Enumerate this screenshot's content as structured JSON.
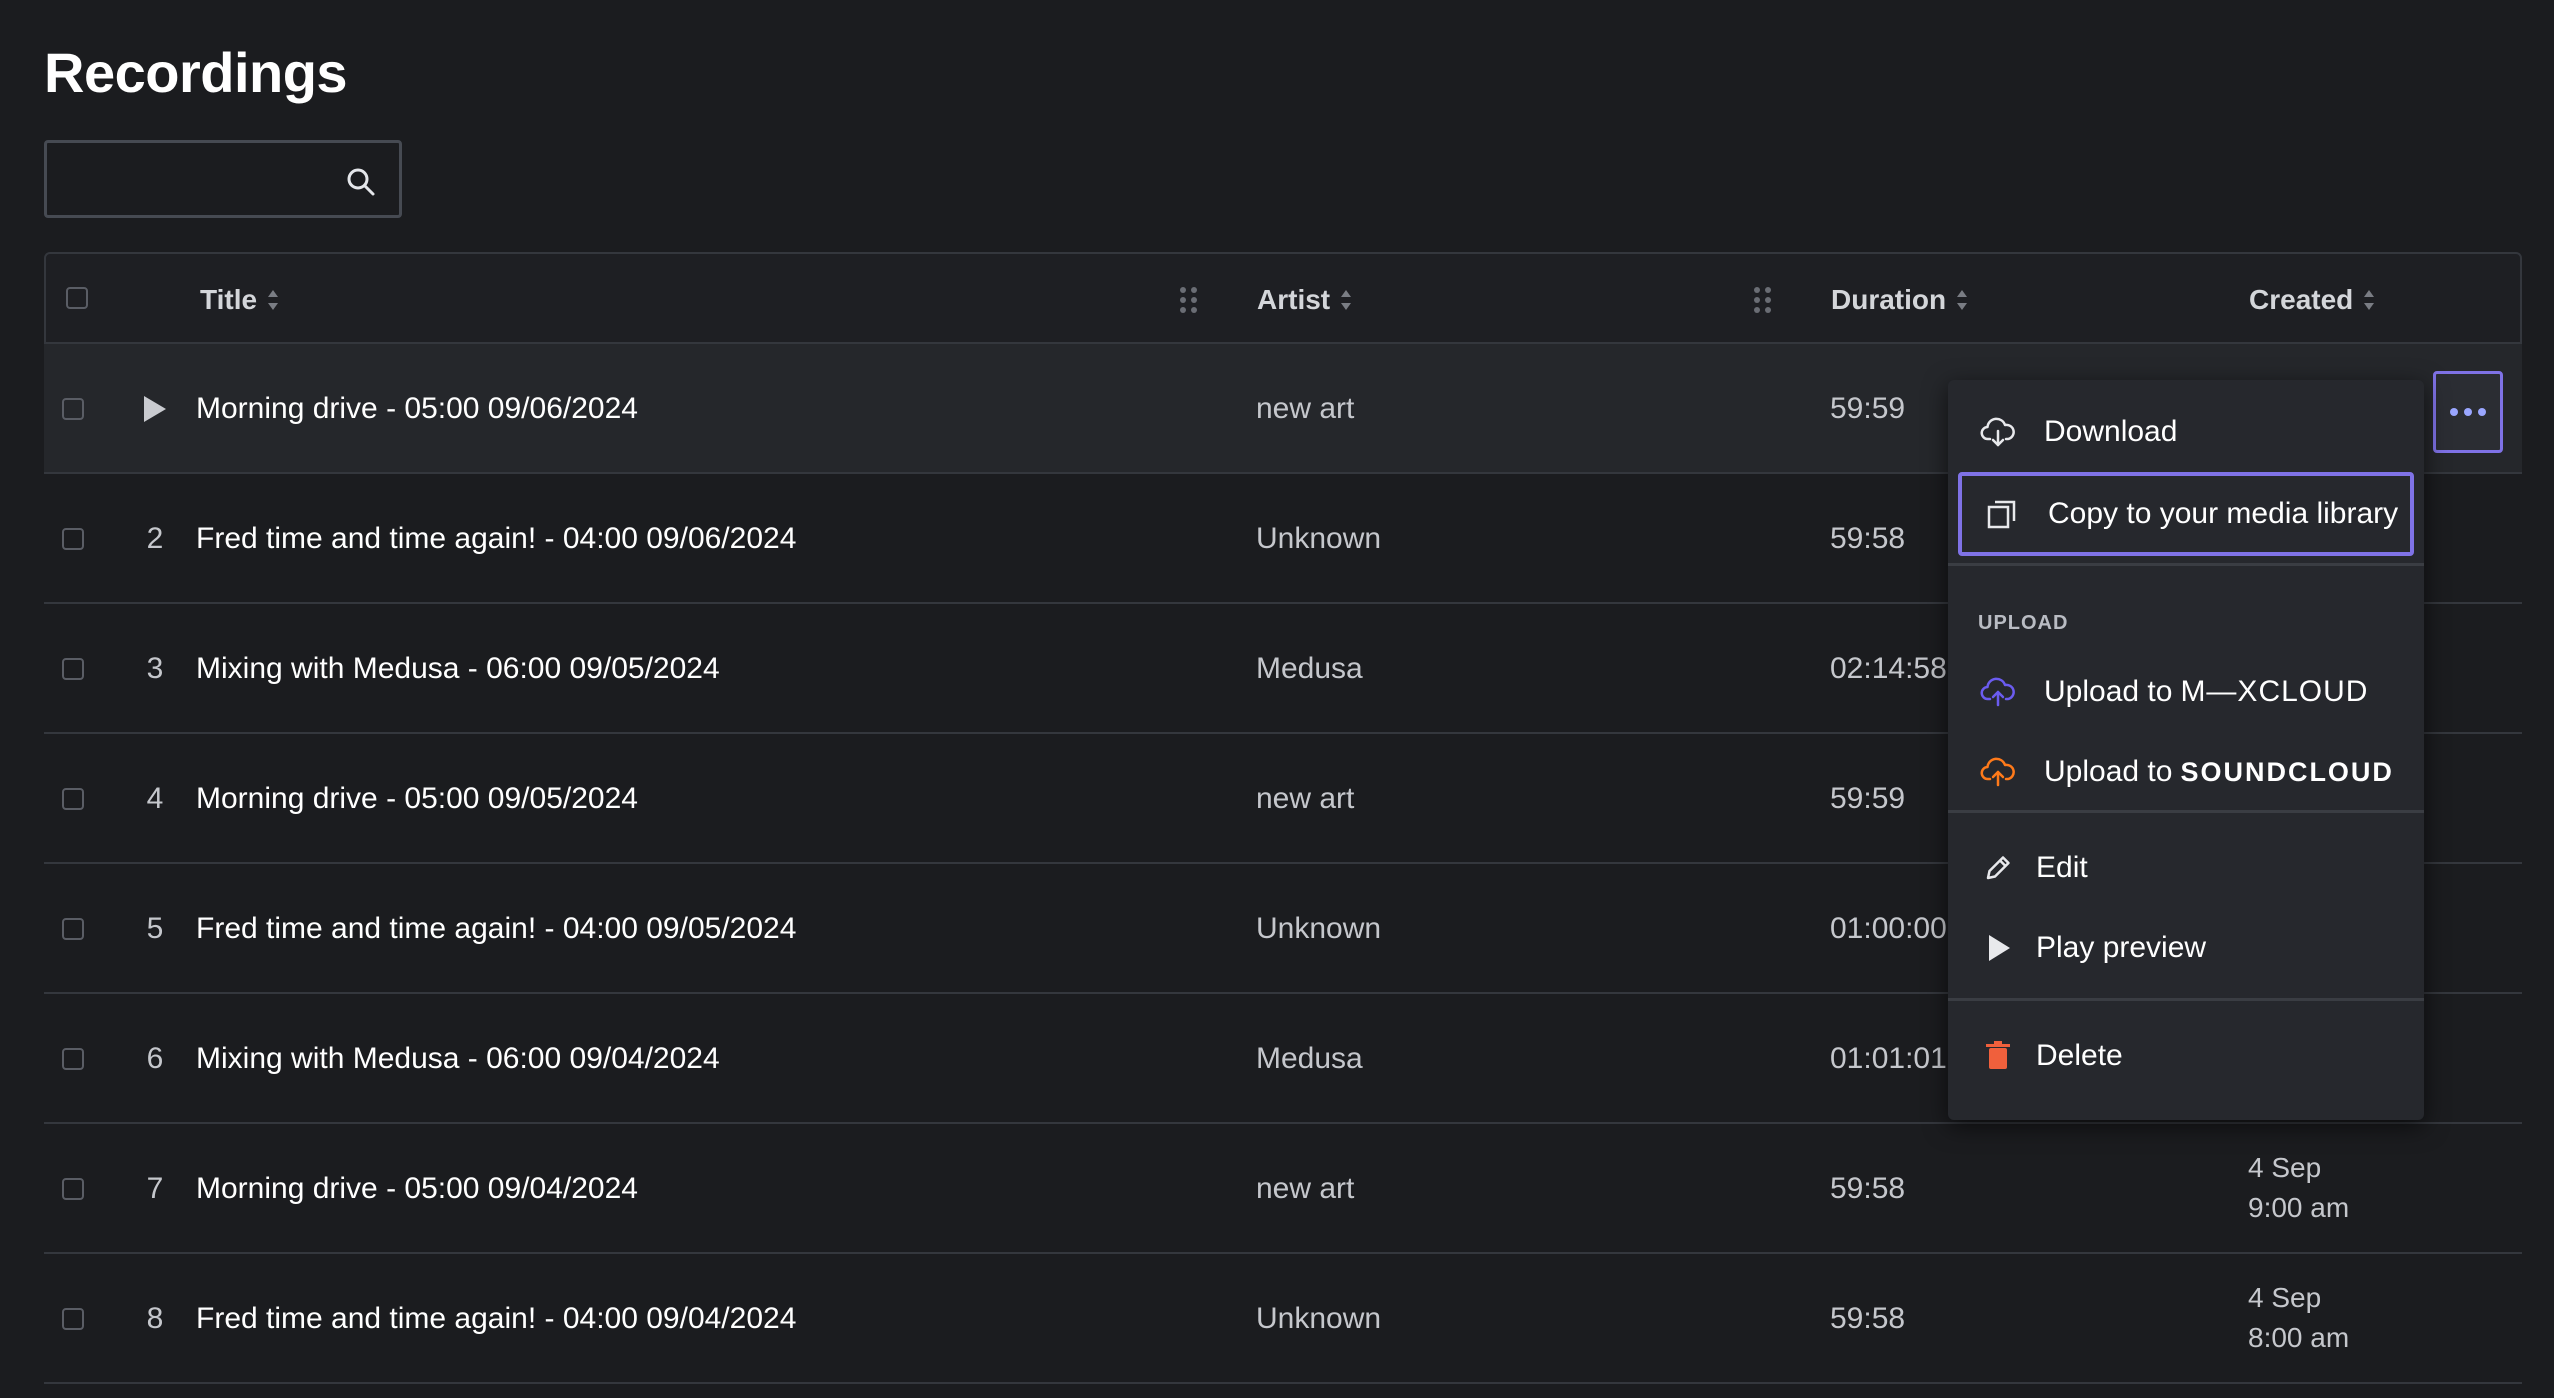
{
  "page": {
    "title": "Recordings"
  },
  "search": {
    "placeholder": "",
    "value": ""
  },
  "table": {
    "columns": {
      "title": "Title",
      "artist": "Artist",
      "duration": "Duration",
      "created": "Created"
    },
    "rows": [
      {
        "index": "",
        "title": "Morning drive - 05:00 09/06/2024",
        "artist": "new art",
        "duration": "59:59",
        "created_date": "",
        "created_time": "",
        "playing": true
      },
      {
        "index": "2",
        "title": "Fred time and time again! - 04:00 09/06/2024",
        "artist": "Unknown",
        "duration": "59:58",
        "created_date": "",
        "created_time": ""
      },
      {
        "index": "3",
        "title": "Mixing with Medusa - 06:00 09/05/2024",
        "artist": "Medusa",
        "duration": "02:14:58",
        "created_date": "",
        "created_time": ""
      },
      {
        "index": "4",
        "title": "Morning drive - 05:00 09/05/2024",
        "artist": "new art",
        "duration": "59:59",
        "created_date": "",
        "created_time": ""
      },
      {
        "index": "5",
        "title": "Fred time and time again! - 04:00 09/05/2024",
        "artist": "Unknown",
        "duration": "01:00:00",
        "created_date": "",
        "created_time": ""
      },
      {
        "index": "6",
        "title": "Mixing with Medusa - 06:00 09/04/2024",
        "artist": "Medusa",
        "duration": "01:01:01",
        "created_date": "",
        "created_time": ""
      },
      {
        "index": "7",
        "title": "Morning drive - 05:00 09/04/2024",
        "artist": "new art",
        "duration": "59:58",
        "created_date": "4 Sep",
        "created_time": "9:00 am"
      },
      {
        "index": "8",
        "title": "Fred time and time again! - 04:00 09/04/2024",
        "artist": "Unknown",
        "duration": "59:58",
        "created_date": "4 Sep",
        "created_time": "8:00 am"
      }
    ]
  },
  "menu": {
    "download": "Download",
    "copy": "Copy to your media library",
    "upload_section": "UPLOAD",
    "upload_to": "Upload to",
    "mixcloud": "M—XCLOUD",
    "soundcloud": "SOUNDCLOUD",
    "edit": "Edit",
    "play_preview": "Play preview",
    "delete": "Delete"
  },
  "colors": {
    "background": "#1b1c1f",
    "accent_focus": "#7f72e6",
    "mixcloud": "#6b5cf0",
    "soundcloud": "#ff7a1a",
    "delete": "#f0603c"
  },
  "icons": {
    "search": "search-icon",
    "download": "cloud-download-icon",
    "copy": "copy-icon",
    "mixcloud_upload": "cloud-upload-icon",
    "soundcloud_upload": "cloud-upload-icon",
    "edit": "pencil-icon",
    "play_preview": "play-icon",
    "delete": "trash-icon",
    "more": "more-horizontal-icon"
  }
}
